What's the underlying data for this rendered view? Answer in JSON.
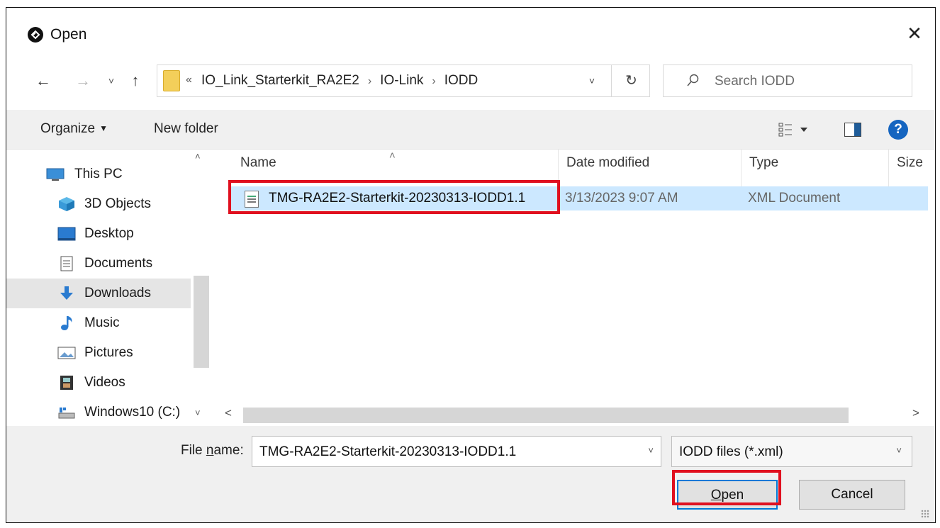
{
  "window": {
    "title": "Open",
    "close_symbol": "✕"
  },
  "nav_buttons": {
    "back_symbol": "←",
    "forward_symbol": "→",
    "recent_symbol": "˅",
    "up_symbol": "↑"
  },
  "address": {
    "prefix": "«",
    "crumbs": [
      "IO_Link_Starterkit_RA2E2",
      "IO-Link",
      "IODD"
    ],
    "separator": "›",
    "dropdown_symbol": "˅",
    "refresh_symbol": "↻"
  },
  "search": {
    "placeholder": "Search IODD"
  },
  "toolbar": {
    "organize_label": "Organize",
    "organize_caret": "▼",
    "new_folder_label": "New folder",
    "help_label": "?"
  },
  "sidebar": {
    "items": [
      {
        "label": "This PC",
        "icon": "pc-icon"
      },
      {
        "label": "3D Objects",
        "icon": "cube-icon"
      },
      {
        "label": "Desktop",
        "icon": "desktop-icon"
      },
      {
        "label": "Documents",
        "icon": "documents-icon"
      },
      {
        "label": "Downloads",
        "icon": "download-icon",
        "selected": true
      },
      {
        "label": "Music",
        "icon": "music-note-icon"
      },
      {
        "label": "Pictures",
        "icon": "pictures-icon"
      },
      {
        "label": "Videos",
        "icon": "film-icon"
      },
      {
        "label": "Windows10 (C:)",
        "icon": "drive-icon"
      }
    ],
    "scroll_up": "˄",
    "scroll_down": "˅"
  },
  "file_list": {
    "columns": [
      "Name",
      "Date modified",
      "Type",
      "Size"
    ],
    "sort_indicator": "˄",
    "rows": [
      {
        "name": "TMG-RA2E2-Starterkit-20230313-IODD1.1",
        "date_modified": "3/13/2023 9:07 AM",
        "type": "XML Document",
        "selected": true
      }
    ],
    "hscroll_left": "<",
    "hscroll_right": ">"
  },
  "footer": {
    "file_name_label_pre": "File ",
    "file_name_label_u": "n",
    "file_name_label_post": "ame:",
    "file_name_value": "TMG-RA2E2-Starterkit-20230313-IODD1.1",
    "file_name_dropdown": "˅",
    "filter_value": "IODD files (*.xml)",
    "filter_dropdown": "˅",
    "open_label_u": "O",
    "open_label_rest": "pen",
    "cancel_label": "Cancel"
  },
  "colors": {
    "selection": "#cce8ff",
    "highlight_box": "#e0101f",
    "accent": "#0078d7",
    "help": "#1565c0"
  }
}
